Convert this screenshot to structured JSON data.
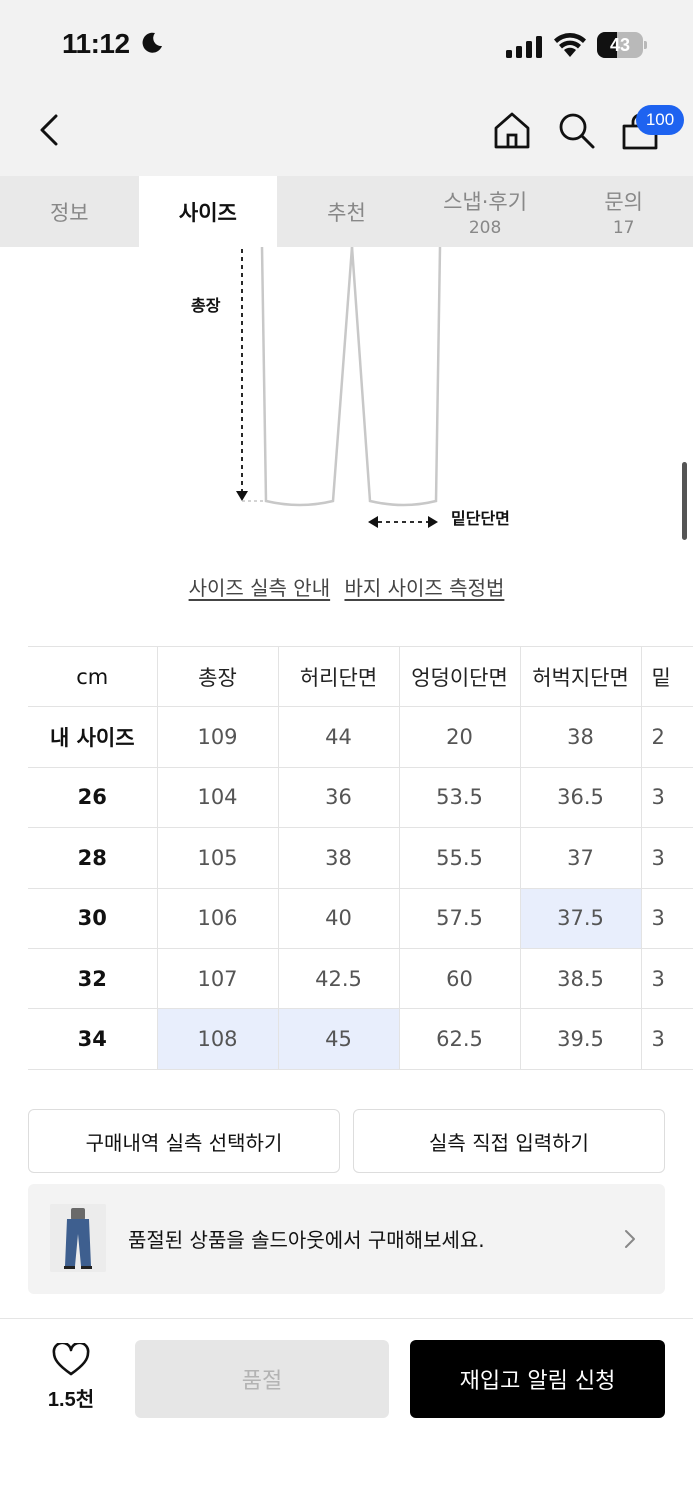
{
  "status_bar": {
    "time": "11:12",
    "battery_level": "43",
    "battery_fraction": 0.43
  },
  "header": {
    "cart_count": "100"
  },
  "tabs": [
    {
      "label": "정보",
      "count": ""
    },
    {
      "label": "사이즈",
      "count": ""
    },
    {
      "label": "추천",
      "count": ""
    },
    {
      "label": "스냅·후기",
      "count": "208"
    },
    {
      "label": "문의",
      "count": "17"
    }
  ],
  "active_tab": "사이즈",
  "diagram": {
    "label_total": "총장",
    "label_hem": "밑단단면"
  },
  "links": {
    "size_guide": "사이즈 실측 안내",
    "measure_guide": "바지 사이즈 측정법"
  },
  "size_table": {
    "headers": [
      "cm",
      "총장",
      "허리단면",
      "엉덩이단면",
      "허벅지단면",
      "밑"
    ],
    "rows": [
      {
        "label": "내 사이즈",
        "values": [
          "109",
          "44",
          "20",
          "38",
          "2"
        ]
      },
      {
        "label": "26",
        "values": [
          "104",
          "36",
          "53.5",
          "36.5",
          "3"
        ]
      },
      {
        "label": "28",
        "values": [
          "105",
          "38",
          "55.5",
          "37",
          "3"
        ]
      },
      {
        "label": "30",
        "values": [
          "106",
          "40",
          "57.5",
          "37.5",
          "3"
        ]
      },
      {
        "label": "32",
        "values": [
          "107",
          "42.5",
          "60",
          "38.5",
          "3"
        ]
      },
      {
        "label": "34",
        "values": [
          "108",
          "45",
          "62.5",
          "39.5",
          "3"
        ]
      }
    ]
  },
  "actions": {
    "select_purchase": "구매내역 실측 선택하기",
    "manual_input": "실측 직접 입력하기"
  },
  "soldout_banner": {
    "text": "품절된 상품을 솔드아웃에서 구매해보세요."
  },
  "bottom_bar": {
    "like_count": "1.5천",
    "soldout_label": "품절",
    "restock_label": "재입고 알림 신청"
  },
  "colors": {
    "accent": "#1e63f0",
    "highlight": "#e8eefc",
    "primary_button": "#000000"
  }
}
